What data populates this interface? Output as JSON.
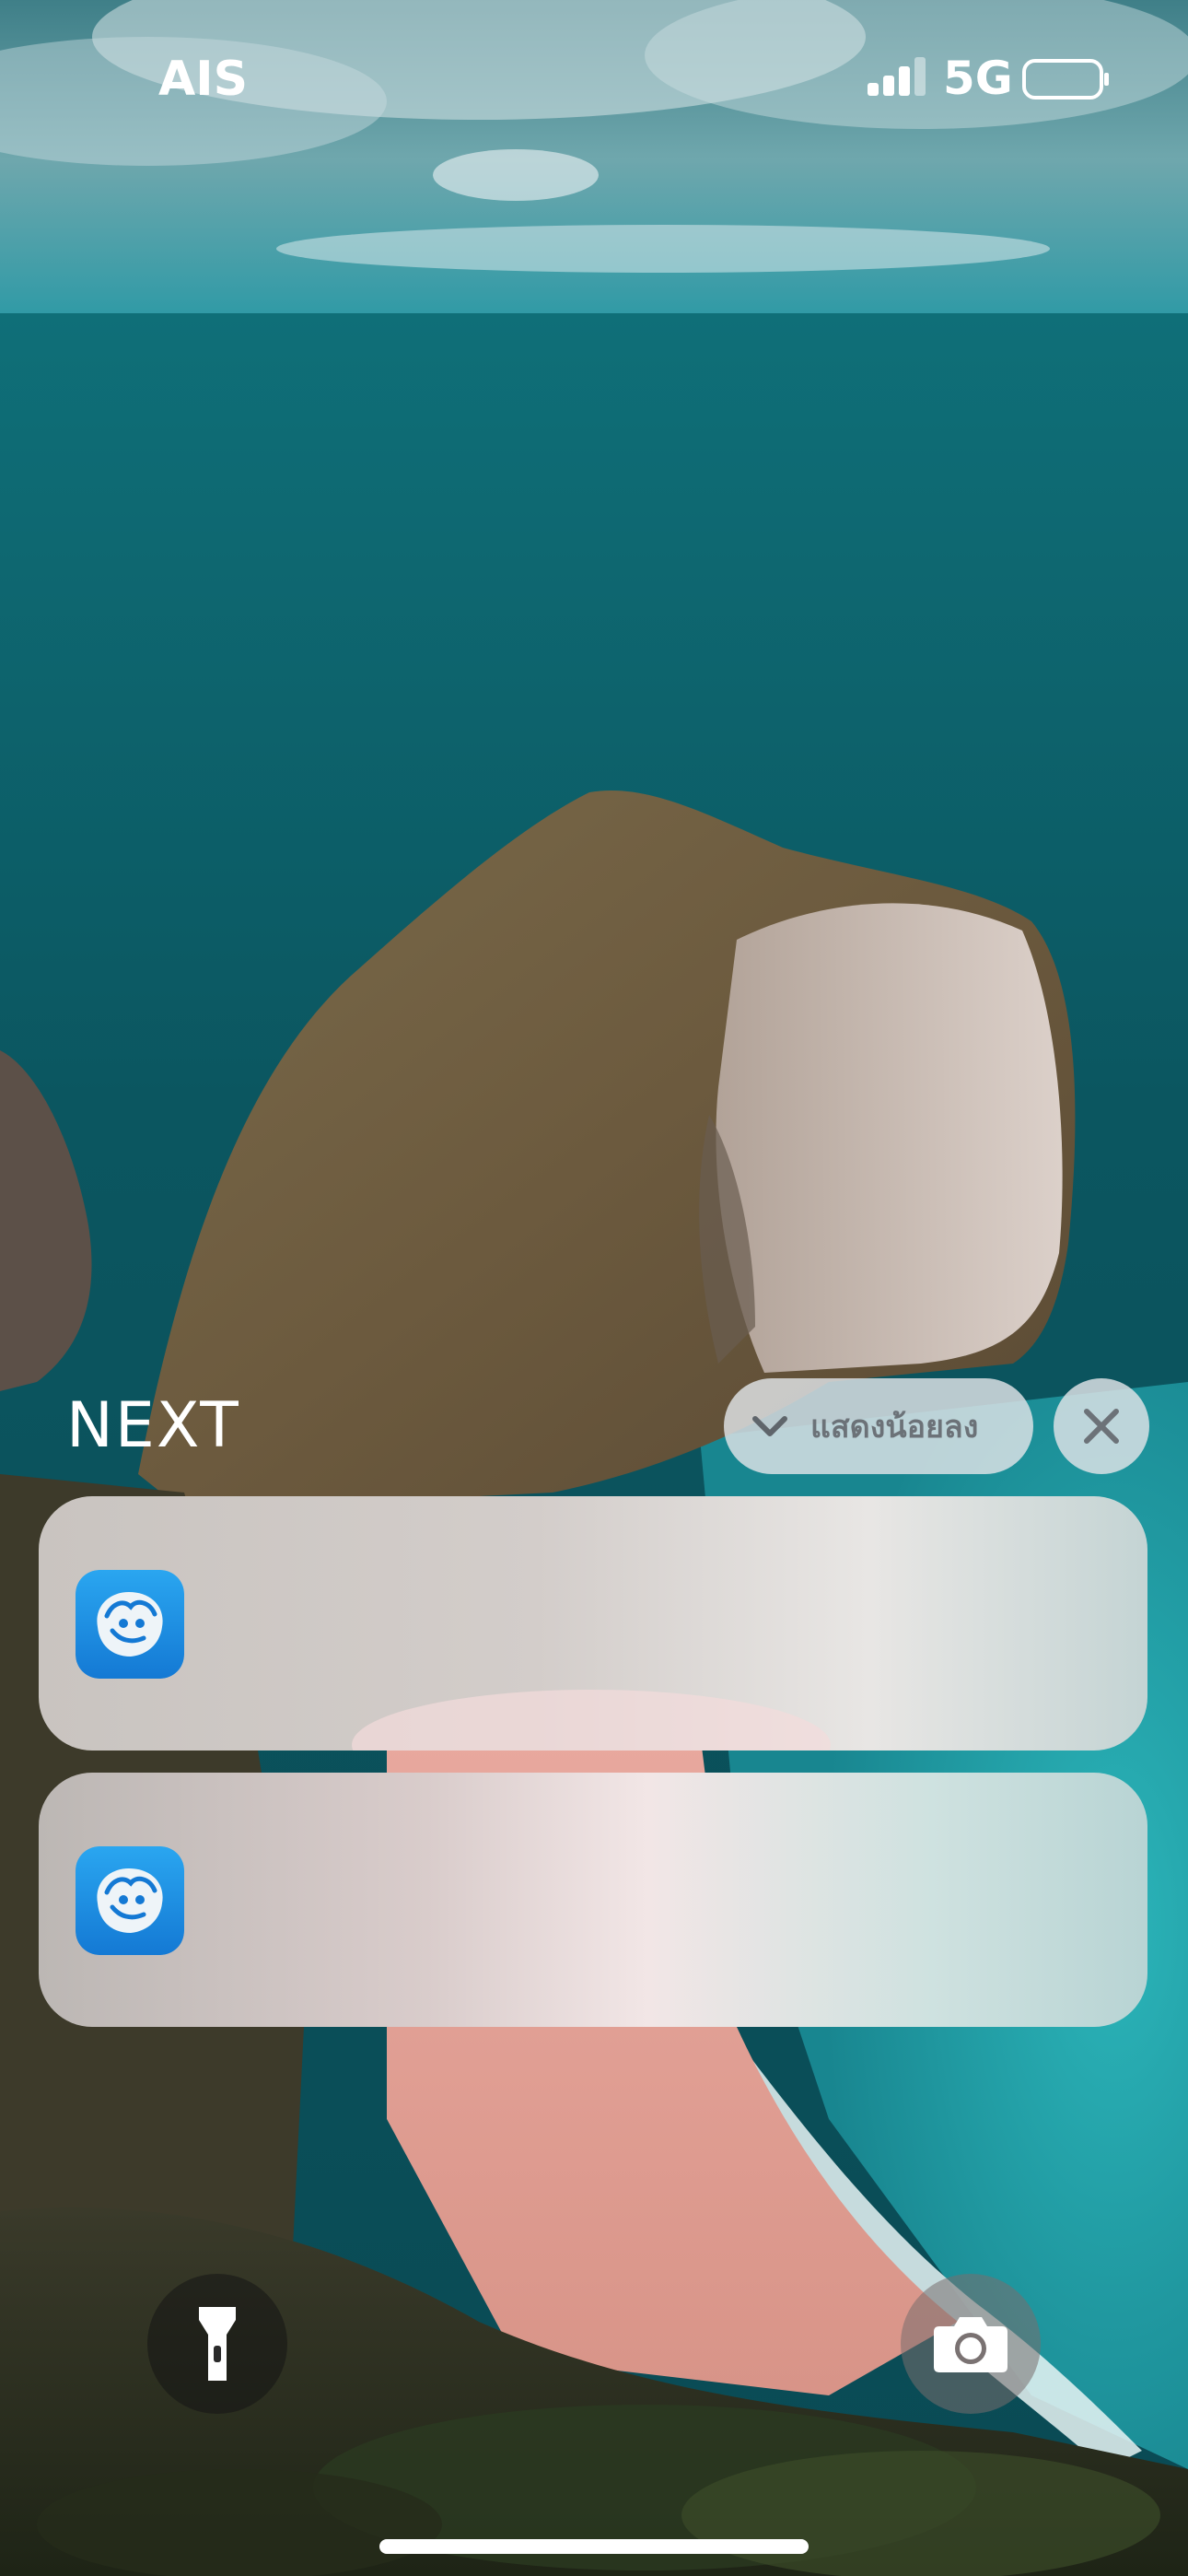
{
  "status_bar": {
    "carrier": "AIS",
    "network": "5G",
    "signal_bars_active": 3,
    "signal_bars_total": 4
  },
  "notification_stack": {
    "title": "NEXT",
    "show_less_label": "แสดงน้อยลง",
    "notifications": [
      {
        "app_icon": "krungthai-next-app-icon"
      },
      {
        "app_icon": "krungthai-next-app-icon"
      }
    ]
  },
  "controls": {
    "flashlight_icon": "flashlight-icon",
    "camera_icon": "camera-icon"
  },
  "colors": {
    "app_icon_blue": "#1a8fe3",
    "pill_background": "#e1e4e8",
    "pill_text": "#6c7278"
  }
}
